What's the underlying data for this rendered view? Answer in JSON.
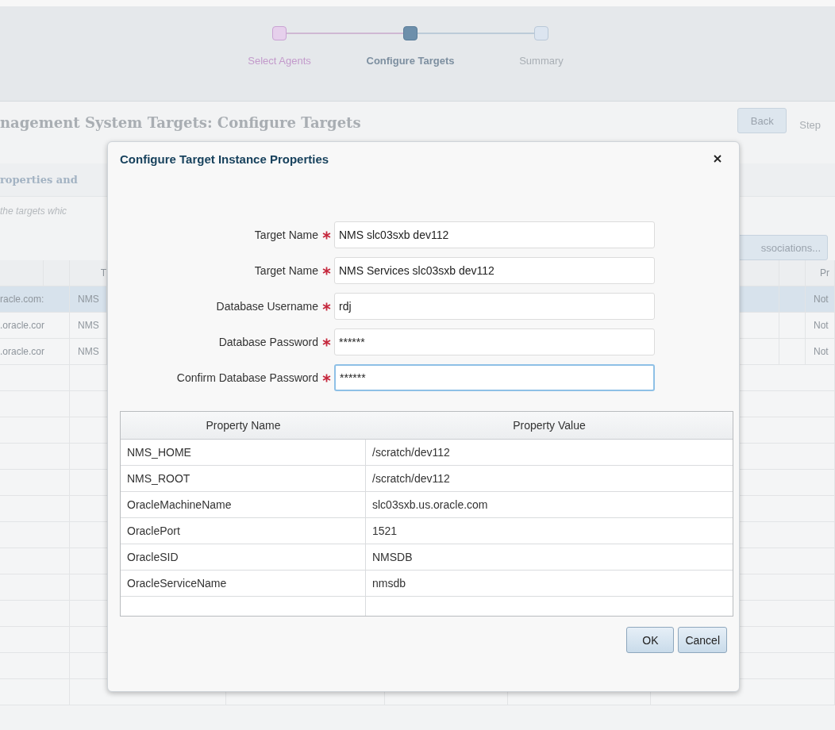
{
  "background": {
    "steps": [
      {
        "label": "Select Agents",
        "selected": false,
        "done": true
      },
      {
        "label": "Configure Targets",
        "selected": true,
        "done": false
      },
      {
        "label": "Summary",
        "selected": false,
        "done": false
      }
    ],
    "heading": "nagement System Targets: Configure Targets",
    "back_button": "Back",
    "step_label": "Step",
    "section_title": "roperties and",
    "hint": "the targets whic",
    "associations_button": "ssociations...",
    "table": {
      "left_header": "T",
      "right_header": "Pr",
      "rows": [
        {
          "host": "racle.com:",
          "name": "NMS",
          "status": "Not",
          "selected": true
        },
        {
          "host": ".oracle.cor",
          "name": "NMS",
          "status": "Not",
          "selected": false
        },
        {
          "host": ".oracle.cor",
          "name": "NMS",
          "status": "Not",
          "selected": false
        }
      ]
    }
  },
  "dialog": {
    "title": "Configure Target Instance Properties",
    "fields": [
      {
        "label": "Target Name",
        "required": true,
        "value": "NMS slc03sxb dev112",
        "focused": false
      },
      {
        "label": "Target Name",
        "required": true,
        "value": "NMS Services slc03sxb dev112",
        "focused": false
      },
      {
        "label": "Database Username",
        "required": true,
        "value": "rdj",
        "focused": false
      },
      {
        "label": "Database Password",
        "required": true,
        "value": "******",
        "focused": false
      },
      {
        "label": "Confirm Database Password",
        "required": true,
        "value": "******",
        "focused": true
      }
    ],
    "table": {
      "columns": [
        "Property Name",
        "Property Value"
      ],
      "rows": [
        [
          "NMS_HOME",
          "/scratch/dev112"
        ],
        [
          "NMS_ROOT",
          "/scratch/dev112"
        ],
        [
          "OracleMachineName",
          "slc03sxb.us.oracle.com"
        ],
        [
          "OraclePort",
          "1521"
        ],
        [
          "OracleSID",
          "NMSDB"
        ],
        [
          "OracleServiceName",
          "nmsdb"
        ]
      ]
    },
    "buttons": [
      "OK",
      "Cancel"
    ]
  }
}
